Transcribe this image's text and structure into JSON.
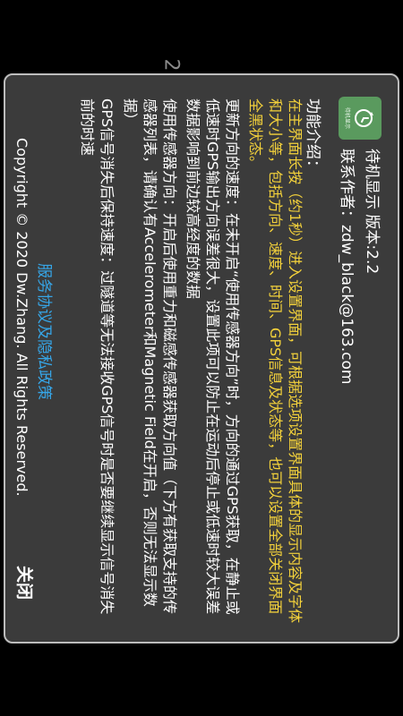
{
  "background": {
    "page_number": "2"
  },
  "dialog": {
    "title": "待机显示  版本:2.2",
    "contact": "联系作者：zdw_black@163.com",
    "heading": "功能介绍：",
    "icon_name": "clock-arrow-icon",
    "icon_tiny_text": "待机显示",
    "paragraphs": [
      {
        "color": "yellow",
        "text": "在主界面长按（约1秒）进入设置界面，可根据选项设置界面具体的显示内容及字体和大小等，包括方向、速度、时间、GPS信息及状态等，也可以设置全部关闭界面全黑状态。"
      },
      {
        "color": "white",
        "text": "更新方向的速度：在未开启“使用传感器方向”时，方向的通过GPS获取，在静止或低速时GPS输出方向误差很大，设置此项可以防止在运动后停止或低速时较大误差数据影响到前边较高经度的数据"
      },
      {
        "color": "white",
        "text": "使用传感器方向：开启后使用重力和磁感传感器获取方向值（下方有获取支持的传感器列表，请确认有Accelerometer和Magnetic Field在开启，否则无法显示数据）"
      },
      {
        "color": "white",
        "text": "GPS信号消失后保持速度：过隧道等无法接收GPS信号时是否要继续显示信号消失前的时速"
      }
    ],
    "policy_link": "服务协议及隐私政策",
    "copyright": "Copyright © 2020 Dw.Zhang. All Rights Reserved.",
    "close_label": "关闭"
  },
  "colors": {
    "dialog_bg": "#3b3b3b",
    "dialog_border": "#bdbdbd",
    "highlight_text": "#f3d13b",
    "link": "#36a6e8",
    "icon_bg": "#5a9a5e"
  }
}
